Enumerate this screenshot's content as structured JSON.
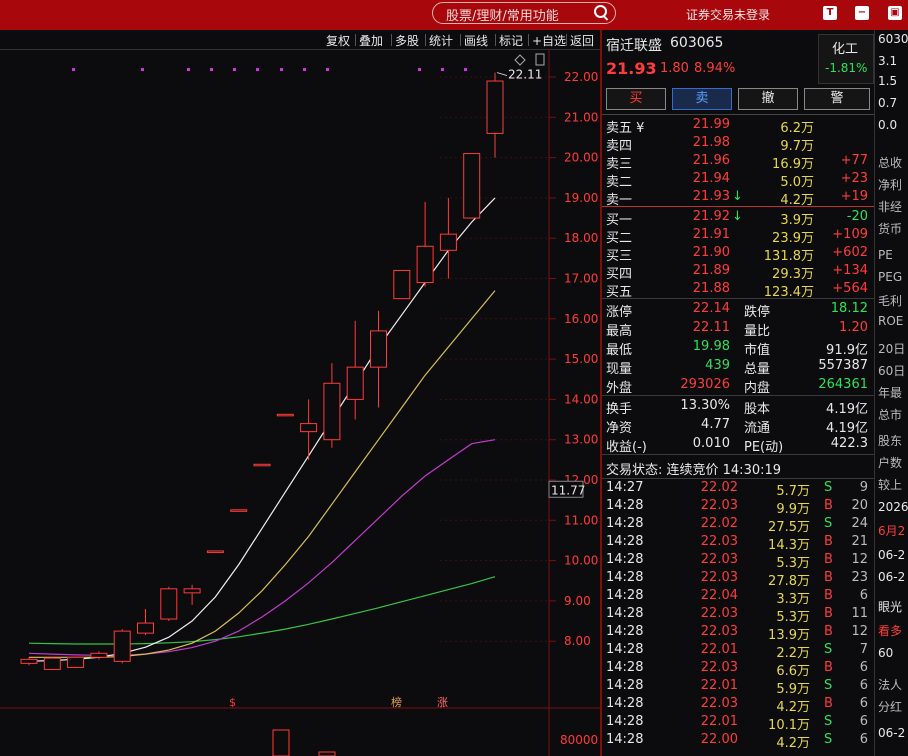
{
  "header": {
    "search_placeholder": "股票/理财/常用功能",
    "login_status": "证券交易未登录",
    "icons": [
      "t-icon",
      "minus-icon",
      "restore-icon",
      "close-icon"
    ]
  },
  "toolbar": [
    "复权",
    "叠加",
    "多股",
    "统计",
    "画线",
    "标记",
    "+自选",
    "返回"
  ],
  "chart": {
    "price_labels": [
      "22.00",
      "21.00",
      "20.00",
      "19.00",
      "18.00",
      "17.00",
      "16.00",
      "15.00",
      "14.00",
      "13.00",
      "12.00",
      "11.00",
      "10.00",
      "9.00",
      "8.00"
    ],
    "current_price_tag": "11.77",
    "high_label": "22.11",
    "volume_label": "80000",
    "markers": [
      "$",
      "榜",
      "涨"
    ]
  },
  "chart_data": {
    "type": "candlestick",
    "title": "",
    "ylim": [
      7.6,
      22.4
    ],
    "candles": [
      {
        "o": 7.45,
        "c": 7.55,
        "h": 7.6,
        "l": 7.4
      },
      {
        "o": 7.3,
        "c": 7.58,
        "h": 7.62,
        "l": 7.28
      },
      {
        "o": 7.35,
        "c": 7.6,
        "h": 7.62,
        "l": 7.33
      },
      {
        "o": 7.6,
        "c": 7.7,
        "h": 7.75,
        "l": 7.55
      },
      {
        "o": 7.5,
        "c": 8.25,
        "h": 8.3,
        "l": 7.45
      },
      {
        "o": 8.2,
        "c": 8.45,
        "h": 8.8,
        "l": 8.15
      },
      {
        "o": 8.55,
        "c": 9.3,
        "h": 9.35,
        "l": 8.5
      },
      {
        "o": 9.2,
        "c": 9.3,
        "h": 9.4,
        "l": 8.9
      },
      {
        "o": 10.24,
        "c": 10.24,
        "h": 10.24,
        "l": 10.24
      },
      {
        "o": 11.26,
        "c": 11.26,
        "h": 11.26,
        "l": 11.26
      },
      {
        "o": 12.39,
        "c": 12.39,
        "h": 12.39,
        "l": 12.39
      },
      {
        "o": 13.63,
        "c": 13.63,
        "h": 13.63,
        "l": 13.63
      },
      {
        "o": 13.2,
        "c": 13.4,
        "h": 14.0,
        "l": 12.5
      },
      {
        "o": 13.0,
        "c": 14.4,
        "h": 14.9,
        "l": 12.8
      },
      {
        "o": 14.0,
        "c": 14.8,
        "h": 15.95,
        "l": 13.5
      },
      {
        "o": 14.8,
        "c": 15.7,
        "h": 16.2,
        "l": 13.8
      },
      {
        "o": 16.5,
        "c": 17.2,
        "h": 17.2,
        "l": 16.5
      },
      {
        "o": 16.9,
        "c": 17.8,
        "h": 18.9,
        "l": 16.8
      },
      {
        "o": 17.7,
        "c": 18.1,
        "h": 19.0,
        "l": 17.0
      },
      {
        "o": 18.5,
        "c": 20.1,
        "h": 20.1,
        "l": 18.5
      },
      {
        "o": 20.6,
        "c": 21.9,
        "h": 22.11,
        "l": 20.0
      }
    ],
    "ma_white": [
      7.5,
      7.52,
      7.55,
      7.6,
      7.7,
      7.85,
      8.1,
      8.5,
      9.1,
      9.9,
      10.8,
      11.7,
      12.6,
      13.5,
      14.4,
      15.3,
      16.1,
      16.9,
      17.7,
      18.4,
      19.0
    ],
    "ma_yellow": [
      7.6,
      7.6,
      7.6,
      7.6,
      7.62,
      7.68,
      7.78,
      7.95,
      8.25,
      8.7,
      9.25,
      9.9,
      10.6,
      11.4,
      12.2,
      13.0,
      13.8,
      14.6,
      15.3,
      16.0,
      16.7
    ],
    "ma_magenta": [
      7.7,
      7.68,
      7.66,
      7.65,
      7.65,
      7.68,
      7.74,
      7.84,
      8.0,
      8.25,
      8.6,
      9.0,
      9.45,
      9.95,
      10.5,
      11.05,
      11.6,
      12.1,
      12.5,
      12.9,
      13.0
    ],
    "ma_green": [
      7.95,
      7.94,
      7.93,
      7.93,
      7.93,
      7.94,
      7.96,
      7.99,
      8.04,
      8.11,
      8.2,
      8.3,
      8.42,
      8.55,
      8.69,
      8.83,
      8.98,
      9.13,
      9.28,
      9.43,
      9.6
    ]
  },
  "stock": {
    "name": "宿迁联盛",
    "code": "603065",
    "price": "21.93",
    "change": "1.80",
    "change_pct": "8.94%",
    "sector": "化工",
    "sector_pct": "-1.81%"
  },
  "buttons": [
    "买",
    "卖",
    "撤",
    "警"
  ],
  "asks": [
    {
      "label": "卖五 ¥",
      "price": "21.99",
      "vol": "6.2万",
      "delta": ""
    },
    {
      "label": "卖四",
      "price": "21.98",
      "vol": "9.7万",
      "delta": ""
    },
    {
      "label": "卖三",
      "price": "21.96",
      "vol": "16.9万",
      "delta": "+77"
    },
    {
      "label": "卖二",
      "price": "21.94",
      "vol": "5.0万",
      "delta": "+23"
    },
    {
      "label": "卖一",
      "price": "21.93",
      "vol": "4.2万",
      "delta": "+19",
      "arrow": "↓"
    }
  ],
  "bids": [
    {
      "label": "买一",
      "price": "21.92",
      "vol": "3.9万",
      "delta": "-20",
      "arrow": "↓"
    },
    {
      "label": "买二",
      "price": "21.91",
      "vol": "23.9万",
      "delta": "+109"
    },
    {
      "label": "买三",
      "price": "21.90",
      "vol": "131.8万",
      "delta": "+602"
    },
    {
      "label": "买四",
      "price": "21.89",
      "vol": "29.3万",
      "delta": "+134"
    },
    {
      "label": "买五",
      "price": "21.88",
      "vol": "123.4万",
      "delta": "+564"
    }
  ],
  "stats1": [
    {
      "l1": "涨停",
      "v1": "22.14",
      "c1": "red",
      "l2": "跌停",
      "v2": "18.12",
      "c2": "green"
    },
    {
      "l1": "最高",
      "v1": "22.11",
      "c1": "red",
      "l2": "量比",
      "v2": "1.20",
      "c2": "red"
    },
    {
      "l1": "最低",
      "v1": "19.98",
      "c1": "green",
      "l2": "市值",
      "v2": "91.9亿",
      "c2": "white"
    },
    {
      "l1": "现量",
      "v1": "439",
      "c1": "green",
      "l2": "总量",
      "v2": "557387",
      "c2": "white"
    },
    {
      "l1": "外盘",
      "v1": "293026",
      "c1": "red",
      "l2": "内盘",
      "v2": "264361",
      "c2": "green"
    }
  ],
  "stats2": [
    {
      "l1": "换手",
      "v1": "13.30%",
      "l2": "股本",
      "v2": "4.19亿"
    },
    {
      "l1": "净资",
      "v1": "4.77",
      "l2": "流通",
      "v2": "4.19亿"
    },
    {
      "l1": "收益(-)",
      "v1": "0.010",
      "l2": "PE(动)",
      "v2": "422.3"
    }
  ],
  "trade_status": "交易状态: 连续竞价 14:30:19",
  "ticks": [
    {
      "t": "14:27",
      "p": "22.02",
      "v": "5.7万",
      "s": "S",
      "n": "9"
    },
    {
      "t": "14:28",
      "p": "22.03",
      "v": "9.9万",
      "s": "B",
      "n": "20"
    },
    {
      "t": "14:28",
      "p": "22.02",
      "v": "27.5万",
      "s": "S",
      "n": "24"
    },
    {
      "t": "14:28",
      "p": "22.03",
      "v": "14.3万",
      "s": "B",
      "n": "21"
    },
    {
      "t": "14:28",
      "p": "22.03",
      "v": "5.3万",
      "s": "B",
      "n": "12"
    },
    {
      "t": "14:28",
      "p": "22.03",
      "v": "27.8万",
      "s": "B",
      "n": "23"
    },
    {
      "t": "14:28",
      "p": "22.04",
      "v": "3.3万",
      "s": "B",
      "n": "6"
    },
    {
      "t": "14:28",
      "p": "22.03",
      "v": "5.3万",
      "s": "B",
      "n": "11"
    },
    {
      "t": "14:28",
      "p": "22.03",
      "v": "13.9万",
      "s": "B",
      "n": "12"
    },
    {
      "t": "14:28",
      "p": "22.01",
      "v": "2.2万",
      "s": "S",
      "n": "7"
    },
    {
      "t": "14:28",
      "p": "22.03",
      "v": "6.6万",
      "s": "B",
      "n": "6"
    },
    {
      "t": "14:28",
      "p": "22.01",
      "v": "5.9万",
      "s": "S",
      "n": "6"
    },
    {
      "t": "14:28",
      "p": "22.03",
      "v": "4.2万",
      "s": "B",
      "n": "6"
    },
    {
      "t": "14:28",
      "p": "22.01",
      "v": "10.1万",
      "s": "S",
      "n": "6"
    },
    {
      "t": "14:28",
      "p": "22.00",
      "v": "4.2万",
      "s": "S",
      "n": "6"
    }
  ],
  "right_column": [
    "6030",
    "3.1",
    "1.5",
    "0.7",
    "0.0",
    "总收",
    "净利",
    "非经",
    "货币",
    "PE",
    "PEG",
    "毛利",
    "ROE",
    "20日",
    "60日",
    "年最",
    "总市",
    "股东",
    "户数",
    "较上",
    "2026",
    "6月2",
    "06-2",
    "06-2",
    "眼光",
    "看多",
    "60",
    "法人",
    "分红",
    "06-2"
  ]
}
